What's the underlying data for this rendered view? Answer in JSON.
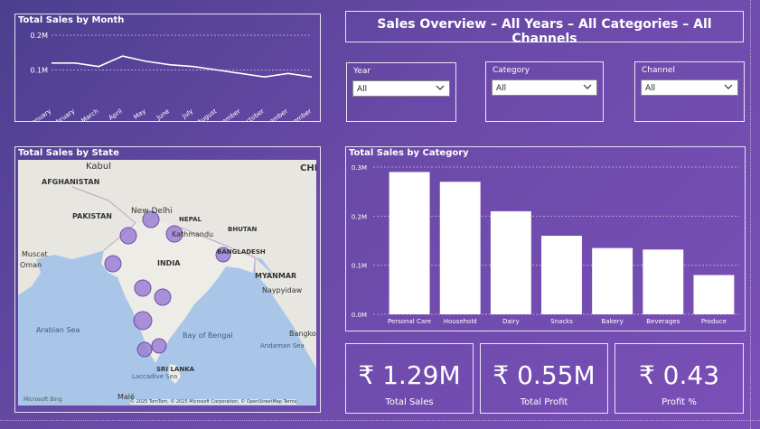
{
  "header": {
    "title": "Sales Overview – All Years – All Categories – All Channels"
  },
  "slicers": {
    "year": {
      "label": "Year",
      "value": "All"
    },
    "category": {
      "label": "Category",
      "value": "All"
    },
    "channel": {
      "label": "Channel",
      "value": "All"
    }
  },
  "month_chart": {
    "title": "Total Sales by Month",
    "y_ticks": [
      "0.2M",
      "0.1M"
    ],
    "chart_data": {
      "type": "line",
      "categories": [
        "January",
        "February",
        "March",
        "April",
        "May",
        "June",
        "July",
        "August",
        "September",
        "October",
        "November",
        "December"
      ],
      "values": [
        0.12,
        0.12,
        0.11,
        0.14,
        0.125,
        0.115,
        0.11,
        0.1,
        0.09,
        0.08,
        0.09,
        0.08
      ],
      "ylim": [
        0,
        0.2
      ]
    }
  },
  "category_chart": {
    "title": "Total Sales by Category",
    "y_ticks": [
      "0.3M",
      "0.2M",
      "0.1M",
      "0.0M"
    ],
    "chart_data": {
      "type": "bar",
      "categories": [
        "Personal Care",
        "Household",
        "Dairy",
        "Snacks",
        "Bakery",
        "Beverages",
        "Produce"
      ],
      "values": [
        0.29,
        0.27,
        0.21,
        0.16,
        0.135,
        0.132,
        0.08
      ],
      "ylim": [
        0,
        0.3
      ]
    },
    "colors": {
      "bar": "#ffffff"
    }
  },
  "map": {
    "title": "Total Sales by State",
    "labels": {
      "kabul": "Kabul",
      "afghanistan": "AFGHANISTAN",
      "pakistan": "PAKISTAN",
      "new_delhi": "New Delhi",
      "nepal": "NEPAL",
      "kathmandu": "Kathmandu",
      "bhutan": "BHUTAN",
      "bangladesh": "BANGLADESH",
      "india": "INDIA",
      "myanmar": "MYANMAR",
      "muscat": "Muscat",
      "oman": "Oman",
      "naypyidaw": "Naypyidaw",
      "arabian_sea": "Arabian Sea",
      "bay_of_bengal": "Bay of Bengal",
      "andaman": "Andaman Sea",
      "laccadive": "Laccadive Sea",
      "sri_lanka": "SRI LANKA",
      "male": "Malé",
      "china": "CHI",
      "bangkok": "Bangkok"
    },
    "attribution": "© 2025 TomTom, © 2025 Microsoft Corporation, © OpenStreetMap  Terms",
    "brand": "Microsoft Bing",
    "bubble_color": "#9b7fd4"
  },
  "kpis": [
    {
      "value": "₹ 1.29M",
      "label": "Total Sales"
    },
    {
      "value": "₹ 0.55M",
      "label": "Total Profit"
    },
    {
      "value": "₹ 0.43",
      "label": "Profit %"
    }
  ]
}
